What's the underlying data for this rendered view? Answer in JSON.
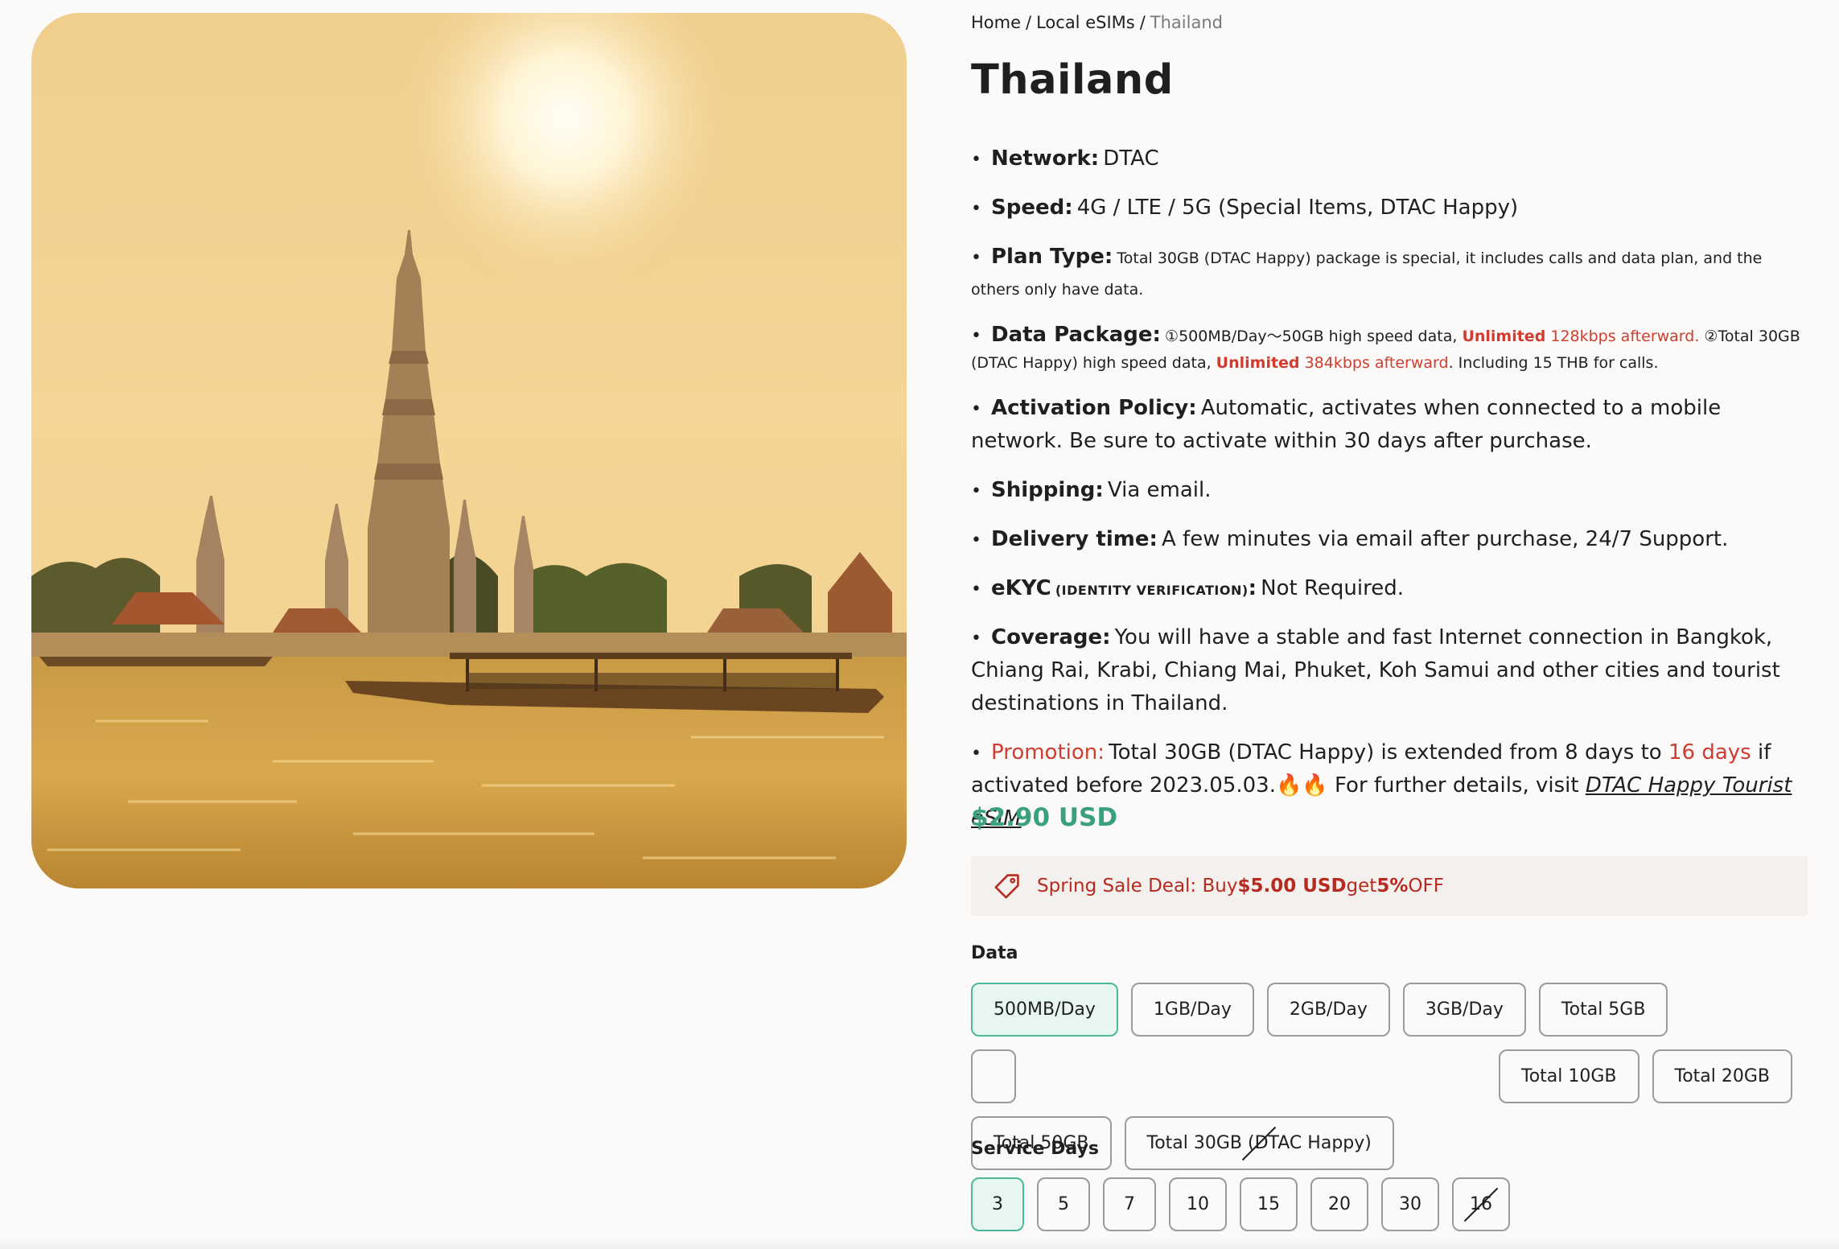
{
  "hero_image": {
    "description_icon": "wat-arun-photo"
  },
  "breadcrumb": {
    "home": "Home",
    "local": "Local eSIMs",
    "current": "Thailand",
    "separator": "/"
  },
  "title": "Thailand",
  "specs": {
    "network": {
      "label": "Network:",
      "value": "DTAC"
    },
    "speed": {
      "label": "Speed:",
      "value": "4G / LTE / 5G (Special Items, DTAC Happy)"
    },
    "plan_type": {
      "label": "Plan Type:",
      "value": "Total 30GB (DTAC Happy) package is special, it includes calls and data plan, and the others only have data."
    },
    "data_package": {
      "label": "Data Package:",
      "part1": "①500MB/Day～50GB high speed data, ",
      "unl1": "Unlimited",
      "rate1": " 128kbps afterward.",
      "part2": " ②Total 30GB (DTAC Happy) high speed data, ",
      "unl2": "Unlimited",
      "rate2": " 384kbps afterward",
      "part3": ". Including 15 THB for calls."
    },
    "activation": {
      "label": "Activation Policy:",
      "value": "Automatic, activates when connected to a mobile network. Be sure to activate within 30 days after purchase."
    },
    "shipping": {
      "label": "Shipping:",
      "value": "Via email."
    },
    "delivery": {
      "label": "Delivery time:",
      "value": "A few minutes via email after purchase, 24/7 Support."
    },
    "ekyc": {
      "label": "eKYC",
      "sub": "(IDENTITY VERIFICATION)",
      "colon": ":",
      "value": "Not Required."
    },
    "coverage": {
      "label": "Coverage:",
      "value": "You will have a stable and fast Internet connection in Bangkok, Chiang Rai, Krabi, Chiang Mai, Phuket, Koh Samui and other cities and tourist destinations in Thailand."
    },
    "promotion": {
      "label": "Promotion:",
      "text1": "Total 30GB (DTAC Happy) is extended from 8 days to ",
      "days": "16 days",
      "text2": " if activated before 2023.05.03.",
      "emoji": "🔥🔥",
      "text3": " For further details, visit ",
      "link": "DTAC Happy Tourist eSIM"
    }
  },
  "price": "$2.90 USD",
  "sale": {
    "prefix": "Spring Sale Deal: Buy ",
    "amount": "$5.00 USD",
    "mid": " get ",
    "pct": "5%",
    "suffix": " OFF"
  },
  "data_section": {
    "label": "Data",
    "options": [
      "500MB/Day",
      "1GB/Day",
      "2GB/Day",
      "3GB/Day",
      "Total 5GB",
      "Total 10GB",
      "Total 20GB",
      "Total 50GB",
      "Total 30GB (DTAC Happy)"
    ],
    "selected": "500MB/Day"
  },
  "days_section": {
    "label": "Service Days",
    "options": [
      "3",
      "5",
      "7",
      "10",
      "15",
      "20",
      "30",
      "16"
    ],
    "selected": "3"
  },
  "colors": {
    "accent_green": "#3aa17c",
    "promo_red": "#d03c2f",
    "selected_border": "#4cb89a"
  }
}
